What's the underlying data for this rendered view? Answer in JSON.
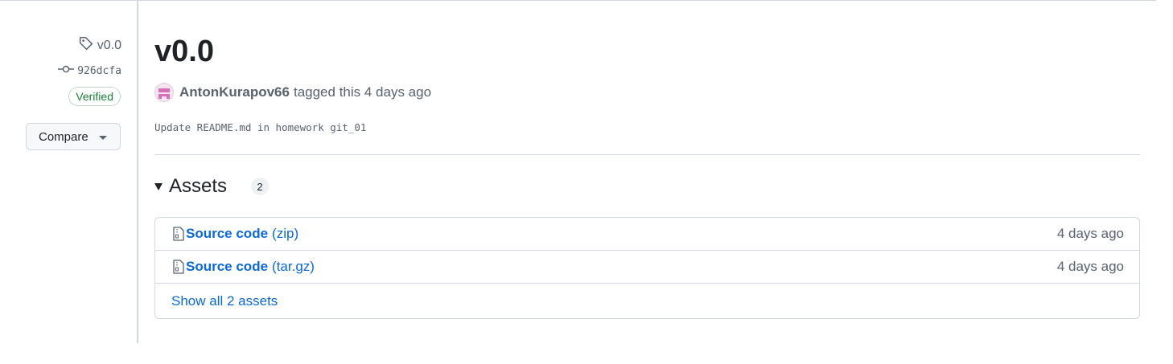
{
  "sidebar": {
    "tag_name": "v0.0",
    "commit_sha": "926dcfa",
    "verified_label": "Verified",
    "compare_label": "Compare"
  },
  "release": {
    "title": "v0.0",
    "author": "AntonKurapov66",
    "action_text": "tagged this 4 days ago",
    "message": "Update README.md in homework git_01"
  },
  "assets": {
    "title": "Assets",
    "count": "2",
    "items": [
      {
        "name": "Source code",
        "format": "(zip)",
        "date": "4 days ago"
      },
      {
        "name": "Source code",
        "format": "(tar.gz)",
        "date": "4 days ago"
      }
    ],
    "show_all_label": "Show all 2 assets"
  },
  "colors": {
    "link": "#0969da",
    "muted": "#59636e",
    "verified": "#1a7f37",
    "border": "#d0d7de"
  }
}
